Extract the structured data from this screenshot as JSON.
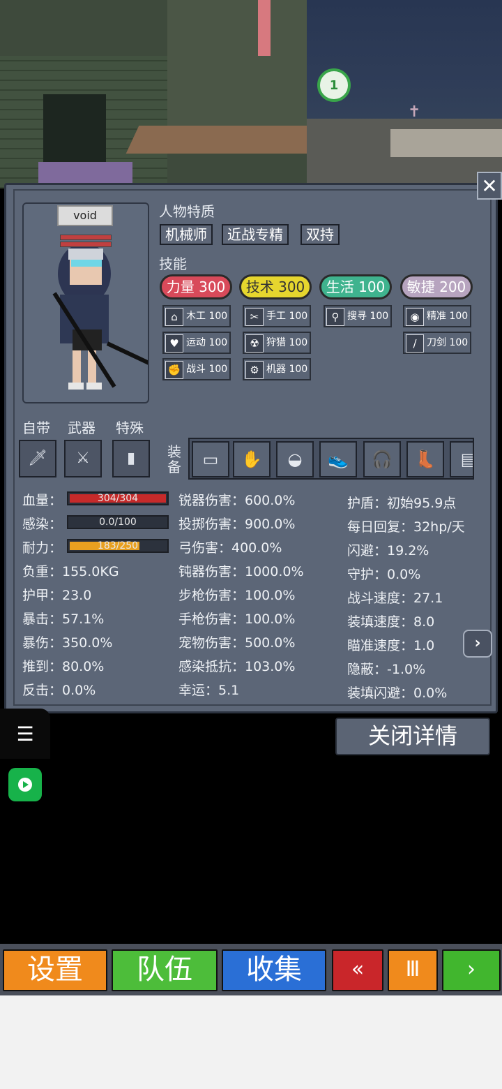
{
  "marker": {
    "label": "1"
  },
  "character": {
    "name": "void"
  },
  "traits_title": "人物特质",
  "traits": [
    "机械师",
    "近战专精",
    "双持"
  ],
  "skills_title": "技能",
  "attributes": [
    {
      "label": "力量 300",
      "color": "#d84a5a"
    },
    {
      "label": "技术 300",
      "color": "#e6d62e"
    },
    {
      "label": "生活 100",
      "color": "#3fb38e"
    },
    {
      "label": "敏捷 200",
      "color": "#b7a4bf"
    }
  ],
  "skills": [
    {
      "label": "木工 100",
      "icon": "house-icon",
      "glyph": "⌂"
    },
    {
      "label": "手工 100",
      "icon": "scissors-icon",
      "glyph": "✂"
    },
    {
      "label": "搜寻 100",
      "icon": "magnifier-icon",
      "glyph": "⚲"
    },
    {
      "label": "精准 100",
      "icon": "eye-icon",
      "glyph": "◉"
    },
    {
      "label": "运动 100",
      "icon": "heart-icon",
      "glyph": "♥"
    },
    {
      "label": "狩猎 100",
      "icon": "radiation-icon",
      "glyph": "☢"
    },
    {
      "label": "刀剑 100",
      "icon": "blade-icon",
      "glyph": "/"
    },
    {
      "label": "战斗 100",
      "icon": "fist-icon",
      "glyph": "✊"
    },
    {
      "label": "机器 100",
      "icon": "gear-icon",
      "glyph": "⚙"
    }
  ],
  "slots": {
    "innate_label": "自带",
    "weapon_label": "武器",
    "special_label": "特殊",
    "equip_label": "装备"
  },
  "stats_left": [
    {
      "label": "血量：",
      "bar": "304/304",
      "pct": 100,
      "color": "#c62a2a"
    },
    {
      "label": "感染：",
      "bar": "0.0/100",
      "pct": 0,
      "color": "#5a6a90"
    },
    {
      "label": "耐力：",
      "bar": "183/250",
      "pct": 73,
      "color": "#e8a020"
    }
  ],
  "stats_left_text": [
    "负重：155.0KG",
    "护甲：23.0",
    "暴击：57.1%",
    "暴伤：350.0%",
    "推到：80.0%",
    "反击：0.0%"
  ],
  "stats_mid": [
    "锐器伤害：600.0%",
    "投掷伤害：900.0%",
    "弓伤害：400.0%",
    "钝器伤害：1000.0%",
    "步枪伤害：100.0%",
    "手枪伤害：100.0%",
    "宠物伤害：500.0%",
    "感染抵抗：103.0%",
    "幸运：5.1"
  ],
  "stats_right": [
    "护盾：初始95.9点",
    "每日回复：32hp/天",
    "闪避：19.2%",
    "守护：0.0%",
    "战斗速度：27.1",
    "装填速度：8.0",
    "瞄准速度：1.0",
    "隐蔽：-1.0%",
    "装填闪避：0.0%"
  ],
  "close_detail": "关闭详情",
  "bottom_buttons": [
    {
      "label": "设置",
      "color": "#f08a1c"
    },
    {
      "label": "队伍",
      "color": "#4dbd3a"
    },
    {
      "label": "收集",
      "color": "#2a6fd6"
    },
    {
      "label": "«",
      "color": "#c9262a"
    },
    {
      "label": "Ⅲ",
      "color": "#f08a1c"
    },
    {
      "label": "›",
      "color": "#41b62e"
    }
  ]
}
